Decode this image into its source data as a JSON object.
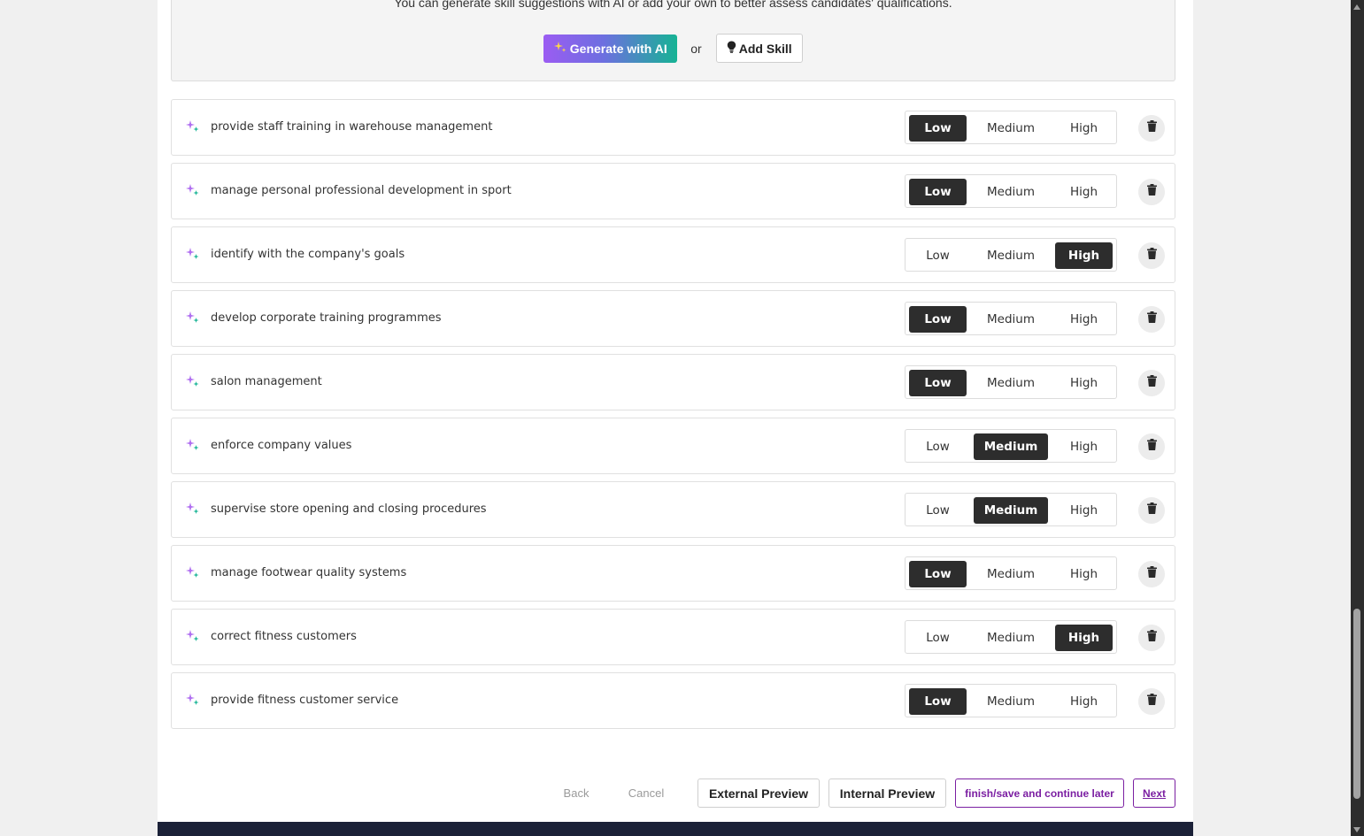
{
  "intro": {
    "text": "You can generate skill suggestions with AI or add your own to better assess candidates' qualifications.",
    "generate_label": "Generate with AI",
    "or_label": "or",
    "add_skill_label": "Add Skill"
  },
  "levels": {
    "low": "Low",
    "medium": "Medium",
    "high": "High"
  },
  "skills": [
    {
      "name": "provide staff training in warehouse management",
      "level": "low"
    },
    {
      "name": "manage personal professional development in sport",
      "level": "low"
    },
    {
      "name": "identify with the company's goals",
      "level": "high"
    },
    {
      "name": "develop corporate training programmes",
      "level": "low"
    },
    {
      "name": "salon management",
      "level": "low"
    },
    {
      "name": "enforce company values",
      "level": "medium"
    },
    {
      "name": "supervise store opening and closing procedures",
      "level": "medium"
    },
    {
      "name": "manage footwear quality systems",
      "level": "low"
    },
    {
      "name": "correct fitness customers",
      "level": "high"
    },
    {
      "name": "provide fitness customer service",
      "level": "low"
    }
  ],
  "footer": {
    "back_label": "Back",
    "cancel_label": "Cancel",
    "external_preview_label": "External Preview",
    "internal_preview_label": "Internal Preview",
    "finish_label": "finish/save and continue later",
    "next_label": "Next"
  },
  "colors": {
    "active_level": "#2d2d2d",
    "accent_purple": "#7b1fa2",
    "ai_gradient_start": "#9b5cf2",
    "ai_gradient_end": "#16b394",
    "footer_bar": "#1b2138"
  },
  "icons": {
    "ai_spark": "sparkle-icon",
    "add_skill": "lightbulb-icon",
    "delete": "trash-icon",
    "skill_marker": "ai-sparkle-icon"
  }
}
